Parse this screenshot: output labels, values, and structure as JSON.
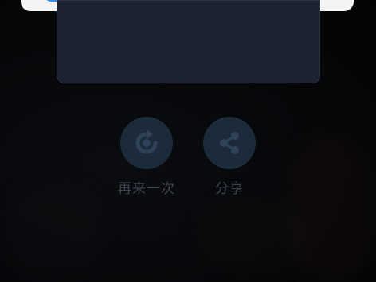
{
  "actions": {
    "replay": {
      "label": "再来一次",
      "icon": "replay-icon"
    },
    "share": {
      "label": "分享",
      "icon": "share-icon"
    }
  },
  "colors": {
    "overlay_bg": "#050608",
    "card_bg": "#1b2230",
    "button_bg": "#1c2b3c",
    "icon": "#314258",
    "label": "#3c4450",
    "accent": "#2f8cff"
  }
}
